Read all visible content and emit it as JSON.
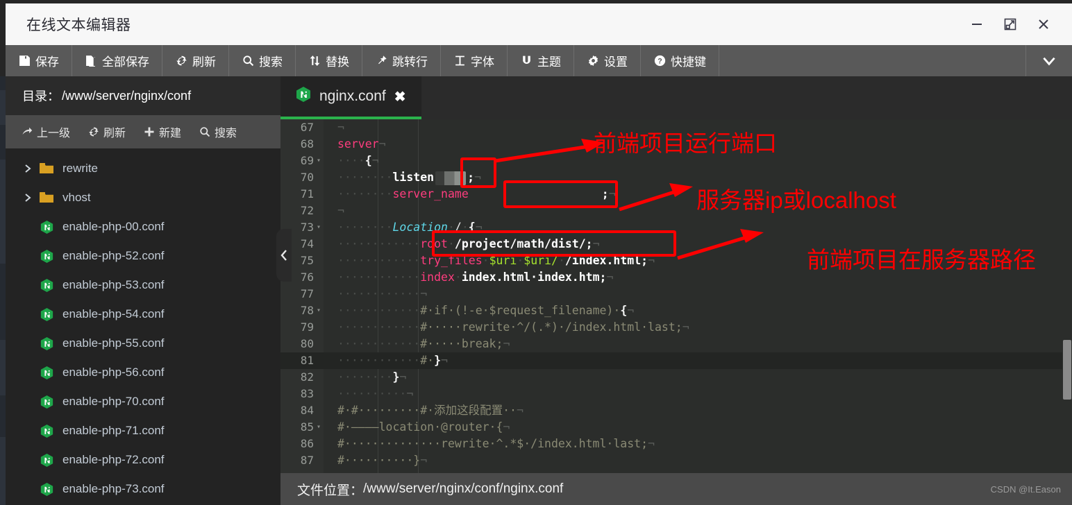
{
  "window": {
    "title": "在线文本编辑器",
    "controls": [
      {
        "name": "minimize",
        "glyph": "minimize-icon"
      },
      {
        "name": "maximize",
        "glyph": "maximize-icon"
      },
      {
        "name": "close",
        "glyph": "close-icon"
      }
    ]
  },
  "toolbar": {
    "items": [
      {
        "label": "保存",
        "icon": "save-icon"
      },
      {
        "label": "全部保存",
        "icon": "save-all-icon"
      },
      {
        "label": "刷新",
        "icon": "refresh-icon"
      },
      {
        "label": "搜索",
        "icon": "search-icon"
      },
      {
        "label": "替换",
        "icon": "replace-icon"
      },
      {
        "label": "跳转行",
        "icon": "goto-line-icon"
      },
      {
        "label": "字体",
        "icon": "font-icon"
      },
      {
        "label": "主题",
        "icon": "theme-icon"
      },
      {
        "label": "设置",
        "icon": "gear-icon"
      },
      {
        "label": "快捷键",
        "icon": "help-icon"
      }
    ],
    "expand_icon": "chevron-down-icon"
  },
  "sidebar": {
    "dir_label": "目录：",
    "dir_path": "/www/server/nginx/conf",
    "ops": [
      {
        "label": "上一级",
        "icon": "arrow-up-level-icon"
      },
      {
        "label": "刷新",
        "icon": "refresh-icon"
      },
      {
        "label": "新建",
        "icon": "plus-icon"
      },
      {
        "label": "搜索",
        "icon": "search-icon"
      }
    ],
    "files": [
      {
        "name": "rewrite",
        "type": "folder"
      },
      {
        "name": "vhost",
        "type": "folder"
      },
      {
        "name": "enable-php-00.conf",
        "type": "file"
      },
      {
        "name": "enable-php-52.conf",
        "type": "file"
      },
      {
        "name": "enable-php-53.conf",
        "type": "file"
      },
      {
        "name": "enable-php-54.conf",
        "type": "file"
      },
      {
        "name": "enable-php-55.conf",
        "type": "file"
      },
      {
        "name": "enable-php-56.conf",
        "type": "file"
      },
      {
        "name": "enable-php-70.conf",
        "type": "file"
      },
      {
        "name": "enable-php-71.conf",
        "type": "file"
      },
      {
        "name": "enable-php-72.conf",
        "type": "file"
      },
      {
        "name": "enable-php-73.conf",
        "type": "file"
      }
    ],
    "collapse_icon": "chevron-left-icon"
  },
  "editor": {
    "tab": {
      "label": "nginx.conf",
      "icon": "nginx-icon",
      "close_icon": "close-icon"
    },
    "first_line": 67,
    "active_line": 81,
    "lines": [
      {
        "n": 67,
        "fold": "",
        "segs": [
          {
            "t": "eol",
            "v": "¬"
          }
        ]
      },
      {
        "n": 68,
        "fold": "",
        "segs": [
          {
            "t": "kw",
            "v": "server"
          },
          {
            "t": "eol",
            "v": "¬"
          }
        ]
      },
      {
        "n": 69,
        "fold": "▾",
        "segs": [
          {
            "t": "dot",
            "v": "····"
          },
          {
            "t": "brace",
            "v": "{"
          },
          {
            "t": "eol",
            "v": "¬"
          }
        ]
      },
      {
        "n": 70,
        "fold": "",
        "segs": [
          {
            "t": "dot",
            "v": "····"
          },
          {
            "t": "dot",
            "v": "····"
          },
          {
            "t": "str",
            "v": "listen"
          },
          {
            "t": "mosaic-port",
            "v": ""
          },
          {
            "t": "str",
            "v": ";"
          },
          {
            "t": "eol",
            "v": "¬"
          }
        ]
      },
      {
        "n": 71,
        "fold": "",
        "segs": [
          {
            "t": "dot",
            "v": "····"
          },
          {
            "t": "dot",
            "v": "····"
          },
          {
            "t": "kw",
            "v": "server_name"
          },
          {
            "t": "mosaic-host",
            "v": ""
          },
          {
            "t": "str",
            "v": ";"
          },
          {
            "t": "eol",
            "v": "¬"
          }
        ]
      },
      {
        "n": 72,
        "fold": "",
        "segs": [
          {
            "t": "eol",
            "v": "¬"
          }
        ]
      },
      {
        "n": 73,
        "fold": "▾",
        "segs": [
          {
            "t": "dot",
            "v": "····"
          },
          {
            "t": "dot",
            "v": "····"
          },
          {
            "t": "loc",
            "v": "Location"
          },
          {
            "t": "dot",
            "v": "·"
          },
          {
            "t": "pun",
            "v": "/"
          },
          {
            "t": "dot",
            "v": "·"
          },
          {
            "t": "brace",
            "v": "{"
          },
          {
            "t": "eol",
            "v": "¬"
          }
        ]
      },
      {
        "n": 74,
        "fold": "",
        "segs": [
          {
            "t": "dot",
            "v": "····"
          },
          {
            "t": "dot",
            "v": "········"
          },
          {
            "t": "kw",
            "v": "root"
          },
          {
            "t": "dot",
            "v": "·"
          },
          {
            "t": "str",
            "v": "/project/math/dist/;"
          },
          {
            "t": "eol",
            "v": "¬"
          }
        ]
      },
      {
        "n": 75,
        "fold": "",
        "segs": [
          {
            "t": "dot",
            "v": "····"
          },
          {
            "t": "dot",
            "v": "········"
          },
          {
            "t": "kw",
            "v": "try_files"
          },
          {
            "t": "dot",
            "v": "·"
          },
          {
            "t": "var",
            "v": "$uri"
          },
          {
            "t": "dot",
            "v": "·"
          },
          {
            "t": "var",
            "v": "$uri/"
          },
          {
            "t": "dot",
            "v": "·"
          },
          {
            "t": "str",
            "v": "/index.html;"
          },
          {
            "t": "eol",
            "v": "¬"
          }
        ]
      },
      {
        "n": 76,
        "fold": "",
        "segs": [
          {
            "t": "dot",
            "v": "····"
          },
          {
            "t": "dot",
            "v": "········"
          },
          {
            "t": "kw",
            "v": "index"
          },
          {
            "t": "dot",
            "v": "·"
          },
          {
            "t": "str",
            "v": "index.html·index.htm;"
          },
          {
            "t": "eol",
            "v": "¬"
          }
        ]
      },
      {
        "n": 77,
        "fold": "",
        "segs": [
          {
            "t": "dot",
            "v": "············"
          },
          {
            "t": "eol",
            "v": "¬"
          }
        ]
      },
      {
        "n": 78,
        "fold": "▾",
        "segs": [
          {
            "t": "dot",
            "v": "············"
          },
          {
            "t": "cmt",
            "v": "#·if·(!-e·$request_filename)·"
          },
          {
            "t": "brace",
            "v": "{"
          },
          {
            "t": "eol",
            "v": "¬"
          }
        ]
      },
      {
        "n": 79,
        "fold": "",
        "segs": [
          {
            "t": "dot",
            "v": "············"
          },
          {
            "t": "cmt",
            "v": "#·····rewrite·^/(.*)·/index.html·last;"
          },
          {
            "t": "eol",
            "v": "¬"
          }
        ]
      },
      {
        "n": 80,
        "fold": "",
        "segs": [
          {
            "t": "dot",
            "v": "············"
          },
          {
            "t": "cmt",
            "v": "#·····break;"
          },
          {
            "t": "eol",
            "v": "¬"
          }
        ]
      },
      {
        "n": 81,
        "fold": "",
        "segs": [
          {
            "t": "dot",
            "v": "············"
          },
          {
            "t": "cmt",
            "v": "#·"
          },
          {
            "t": "brace",
            "v": "}"
          },
          {
            "t": "eol",
            "v": "¬"
          }
        ]
      },
      {
        "n": 82,
        "fold": "",
        "segs": [
          {
            "t": "dot",
            "v": "········"
          },
          {
            "t": "brace",
            "v": "}"
          },
          {
            "t": "eol",
            "v": "¬"
          }
        ]
      },
      {
        "n": 83,
        "fold": "",
        "segs": [
          {
            "t": "dot",
            "v": "··········"
          },
          {
            "t": "eol",
            "v": "¬"
          }
        ]
      },
      {
        "n": 84,
        "fold": "",
        "segs": [
          {
            "t": "cmt",
            "v": "#·#·········#·添加这段配置··"
          },
          {
            "t": "eol",
            "v": "¬"
          }
        ]
      },
      {
        "n": 85,
        "fold": "▾",
        "segs": [
          {
            "t": "cmt",
            "v": "#·————location·@router·{"
          },
          {
            "t": "eol",
            "v": "¬"
          }
        ]
      },
      {
        "n": 86,
        "fold": "",
        "segs": [
          {
            "t": "cmt",
            "v": "#··············rewrite·^.*$·/index.html·last;"
          },
          {
            "t": "eol",
            "v": "¬"
          }
        ]
      },
      {
        "n": 87,
        "fold": "",
        "segs": [
          {
            "t": "cmt",
            "v": "#··········}"
          },
          {
            "t": "eol",
            "v": "¬"
          }
        ]
      }
    ]
  },
  "annotations": [
    {
      "text": "前端项目运行端口",
      "target": "listen-port"
    },
    {
      "text": "服务器ip或localhost",
      "target": "server-name"
    },
    {
      "text": "前端项目在服务器路径",
      "target": "root-path"
    }
  ],
  "status": {
    "location_label": "文件位置：",
    "location_path": "/www/server/nginx/conf/nginx.conf",
    "watermark": "CSDN @It.Eason"
  }
}
